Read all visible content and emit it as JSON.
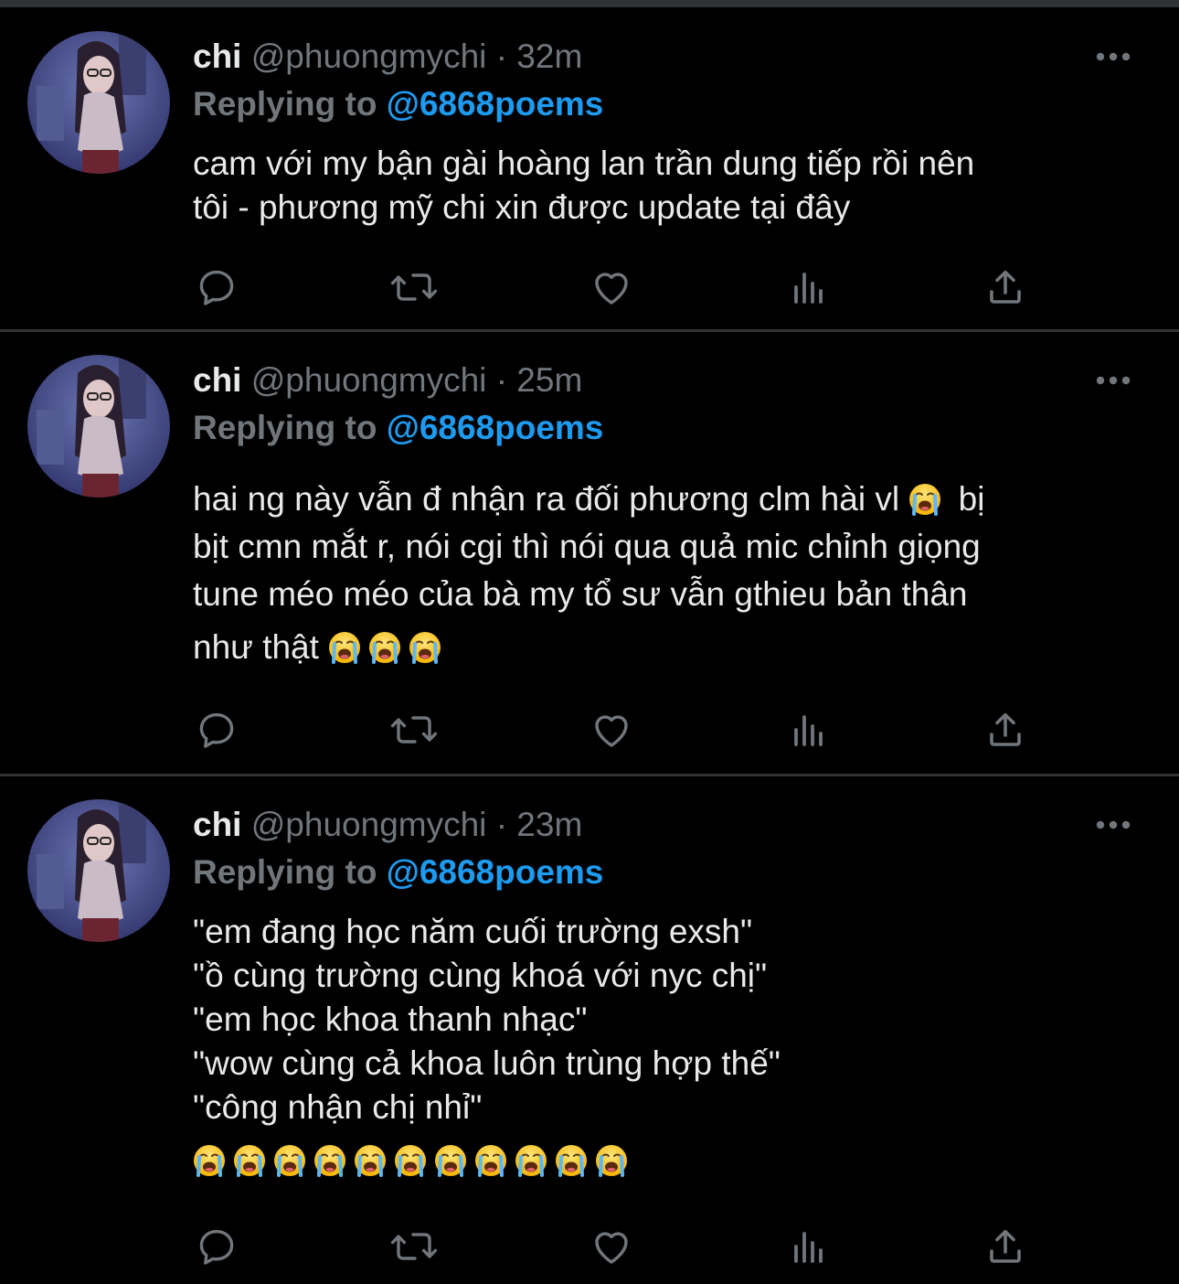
{
  "theme": {
    "background": "#000000",
    "text": "#e7e9ea",
    "muted": "#71767b",
    "accent": "#1d9bf0",
    "divider": "#2f3336"
  },
  "tweets": [
    {
      "display_name": "chi",
      "handle": "@phuongmychi",
      "separator": "·",
      "time": "32m",
      "reply_prefix": "Replying to",
      "reply_handle": "@6868poems",
      "lines": [
        "cam với my bận gài hoàng lan trần dung tiếp rồi nên",
        "tôi - phương mỹ chi xin được update tại đây"
      ],
      "line_emojis": [
        0,
        0
      ],
      "actions": [
        "reply-icon",
        "retweet-icon",
        "like-icon",
        "analytics-icon",
        "share-icon"
      ]
    },
    {
      "display_name": "chi",
      "handle": "@phuongmychi",
      "separator": "·",
      "time": "25m",
      "reply_prefix": "Replying to",
      "reply_handle": "@6868poems",
      "lines": [
        "hai ng này vẫn đ nhận ra đối phương clm hài vl",
        "bịt cmn mắt r, nói cgi thì nói qua quả mic chỉnh giọng",
        "tune méo méo của bà my tổ sư vẫn gthieu bản thân",
        "như thật"
      ],
      "line0_suffix": " bị",
      "line_emojis": [
        1,
        0,
        0,
        3
      ],
      "actions": [
        "reply-icon",
        "retweet-icon",
        "like-icon",
        "analytics-icon",
        "share-icon"
      ]
    },
    {
      "display_name": "chi",
      "handle": "@phuongmychi",
      "separator": "·",
      "time": "23m",
      "reply_prefix": "Replying to",
      "reply_handle": "@6868poems",
      "lines": [
        "\"em đang học năm cuối trường exsh\"",
        "\"ồ cùng trường cùng khoá với nyc chị\"",
        "\"em học khoa thanh nhạc\"",
        "\"wow cùng cả khoa luôn trùng hợp thế\"",
        "\"công nhận chị nhỉ\""
      ],
      "emoji_row_count": 11,
      "actions": [
        "reply-icon",
        "retweet-icon",
        "like-icon",
        "analytics-icon",
        "share-icon"
      ]
    }
  ],
  "emoji_name": "loudly-crying-face-emoji"
}
